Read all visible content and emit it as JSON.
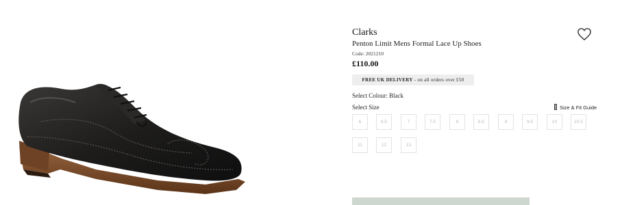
{
  "product": {
    "brand": "Clarks",
    "name": "Penton Limit Mens Formal Lace Up Shoes",
    "code": "Code: 2021210",
    "price": "£110.00",
    "image_alt": "Black leather brogue shoe"
  },
  "delivery": {
    "bold": "FREE UK DELIVERY",
    "rest": " - on all orders over £50"
  },
  "colour": {
    "label": "Select Colour: Black"
  },
  "size": {
    "label": "Select Size",
    "guide_label": "Size & Fit Guide",
    "options": [
      "6",
      "6.5",
      "7",
      "7.5",
      "8",
      "8.5",
      "9",
      "9.5",
      "10",
      "10.5",
      "11",
      "12",
      "13"
    ]
  },
  "icons": {
    "wishlist": "heart-icon",
    "size_guide": "ruler-icon"
  },
  "colors": {
    "button_bg": "#cdd6cf",
    "banner_bg": "#eeeeee",
    "shoe_leather": "#1c1b1a",
    "sole": "#7a4a2a"
  }
}
